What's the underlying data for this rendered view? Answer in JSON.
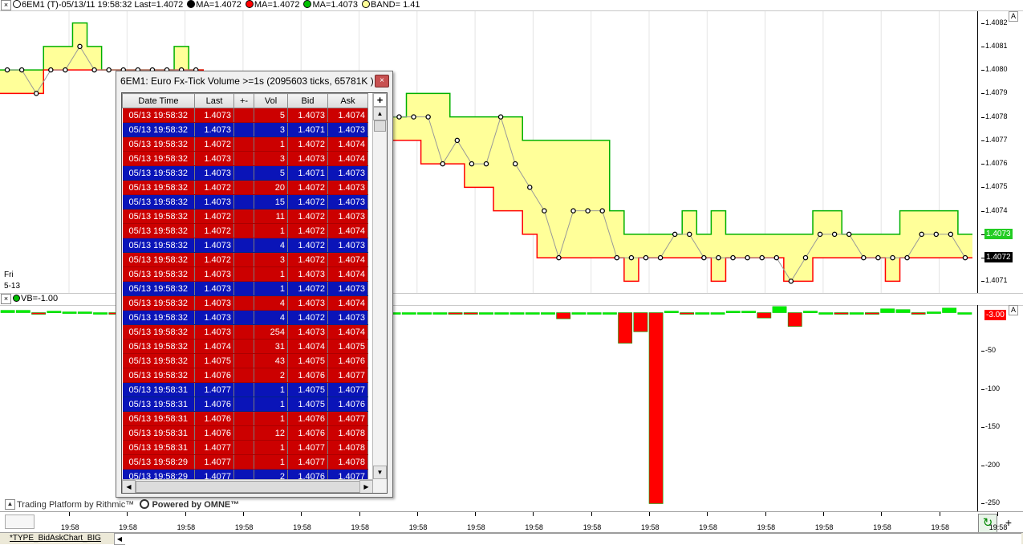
{
  "legend": {
    "close_glyph": "×",
    "symbol_text": "6EM1 (T)-05/13/11 19:58:32 Last=1.4072",
    "ma1": "MA=1.4072",
    "ma2": "MA=1.4072",
    "ma3": "MA=1.4073",
    "band": "BAND= 1.41",
    "colors": {
      "ma1": "#000000",
      "ma2": "#ff0000",
      "ma3": "#00c000",
      "band": "#ffff99"
    }
  },
  "price_axis": {
    "ticks": [
      "1.4082",
      "1.4081",
      "1.4080",
      "1.4079",
      "1.4078",
      "1.4077",
      "1.4076",
      "1.4075",
      "1.4074",
      "1.4073",
      "1.4072",
      "1.4071"
    ],
    "green_tag": "1.4073",
    "last_tag": "1.4072",
    "autoscale_label": "A"
  },
  "date_label": {
    "day": "Fri",
    "date": "5-13"
  },
  "volume_pane": {
    "legend": "VB=-1.00",
    "ticks": [
      "-50",
      "-100",
      "-150",
      "-200",
      "-250"
    ],
    "current_tag": "-3.00",
    "autoscale_label": "A"
  },
  "time_axis": {
    "labels": [
      "19:58",
      "19:58",
      "19:58",
      "19:58",
      "19:58",
      "19:58",
      "19:58",
      "19:58",
      "19:58",
      "19:58",
      "19:58",
      "19:58",
      "19:58",
      "19:58",
      "19:58",
      "19:58",
      "19:58"
    ]
  },
  "branding": {
    "rithmic": "Trading Platform by Rithmic™",
    "omne": "Powered by OMNE™"
  },
  "tab": {
    "label": "*TYPE_BidAskChart_BIG"
  },
  "popup": {
    "title": "6EM1: Euro Fx-Tick Volume >=1s (2095603 ticks, 65781K )",
    "close_glyph": "×",
    "add_glyph": "+",
    "columns": [
      "Date Time",
      "Last",
      "+-",
      "Vol",
      "Bid",
      "Ask"
    ],
    "rows": [
      {
        "side": "red",
        "dt": "05/13 19:58:32",
        "last": "1.4073",
        "vol": "5",
        "bid": "1.4073",
        "ask": "1.4074"
      },
      {
        "side": "blue",
        "dt": "05/13 19:58:32",
        "last": "1.4073",
        "vol": "3",
        "bid": "1.4071",
        "ask": "1.4073"
      },
      {
        "side": "red",
        "dt": "05/13 19:58:32",
        "last": "1.4072",
        "vol": "1",
        "bid": "1.4072",
        "ask": "1.4074"
      },
      {
        "side": "red",
        "dt": "05/13 19:58:32",
        "last": "1.4073",
        "vol": "3",
        "bid": "1.4073",
        "ask": "1.4074"
      },
      {
        "side": "blue",
        "dt": "05/13 19:58:32",
        "last": "1.4073",
        "vol": "5",
        "bid": "1.4071",
        "ask": "1.4073"
      },
      {
        "side": "red",
        "dt": "05/13 19:58:32",
        "last": "1.4072",
        "vol": "20",
        "bid": "1.4072",
        "ask": "1.4073"
      },
      {
        "side": "blue",
        "dt": "05/13 19:58:32",
        "last": "1.4073",
        "vol": "15",
        "bid": "1.4072",
        "ask": "1.4073"
      },
      {
        "side": "red",
        "dt": "05/13 19:58:32",
        "last": "1.4072",
        "vol": "11",
        "bid": "1.4072",
        "ask": "1.4073"
      },
      {
        "side": "red",
        "dt": "05/13 19:58:32",
        "last": "1.4072",
        "vol": "1",
        "bid": "1.4072",
        "ask": "1.4074"
      },
      {
        "side": "blue",
        "dt": "05/13 19:58:32",
        "last": "1.4073",
        "vol": "4",
        "bid": "1.4072",
        "ask": "1.4073"
      },
      {
        "side": "red",
        "dt": "05/13 19:58:32",
        "last": "1.4072",
        "vol": "3",
        "bid": "1.4072",
        "ask": "1.4074"
      },
      {
        "side": "red",
        "dt": "05/13 19:58:32",
        "last": "1.4073",
        "vol": "1",
        "bid": "1.4073",
        "ask": "1.4074"
      },
      {
        "side": "blue",
        "dt": "05/13 19:58:32",
        "last": "1.4073",
        "vol": "1",
        "bid": "1.4072",
        "ask": "1.4073"
      },
      {
        "side": "red",
        "dt": "05/13 19:58:32",
        "last": "1.4073",
        "vol": "4",
        "bid": "1.4073",
        "ask": "1.4074"
      },
      {
        "side": "blue",
        "dt": "05/13 19:58:32",
        "last": "1.4073",
        "vol": "4",
        "bid": "1.4072",
        "ask": "1.4073"
      },
      {
        "side": "red",
        "dt": "05/13 19:58:32",
        "last": "1.4073",
        "vol": "254",
        "bid": "1.4073",
        "ask": "1.4074"
      },
      {
        "side": "red",
        "dt": "05/13 19:58:32",
        "last": "1.4074",
        "vol": "31",
        "bid": "1.4074",
        "ask": "1.4075"
      },
      {
        "side": "red",
        "dt": "05/13 19:58:32",
        "last": "1.4075",
        "vol": "43",
        "bid": "1.4075",
        "ask": "1.4076"
      },
      {
        "side": "red",
        "dt": "05/13 19:58:32",
        "last": "1.4076",
        "vol": "2",
        "bid": "1.4076",
        "ask": "1.4077"
      },
      {
        "side": "blue",
        "dt": "05/13 19:58:31",
        "last": "1.4077",
        "vol": "1",
        "bid": "1.4075",
        "ask": "1.4077"
      },
      {
        "side": "blue",
        "dt": "05/13 19:58:31",
        "last": "1.4076",
        "vol": "1",
        "bid": "1.4075",
        "ask": "1.4076"
      },
      {
        "side": "red",
        "dt": "05/13 19:58:31",
        "last": "1.4076",
        "vol": "1",
        "bid": "1.4076",
        "ask": "1.4077"
      },
      {
        "side": "red",
        "dt": "05/13 19:58:31",
        "last": "1.4076",
        "vol": "12",
        "bid": "1.4076",
        "ask": "1.4078"
      },
      {
        "side": "red",
        "dt": "05/13 19:58:31",
        "last": "1.4077",
        "vol": "1",
        "bid": "1.4077",
        "ask": "1.4078"
      },
      {
        "side": "red",
        "dt": "05/13 19:58:29",
        "last": "1.4077",
        "vol": "1",
        "bid": "1.4077",
        "ask": "1.4078"
      },
      {
        "side": "blue",
        "dt": "05/13 19:58:29",
        "last": "1.4077",
        "vol": "2",
        "bid": "1.4076",
        "ask": "1.4077"
      }
    ]
  },
  "chart_data": {
    "type": "line",
    "ylim": [
      1.40705,
      1.40825
    ],
    "series": [
      {
        "values": [
          1.408,
          1.408,
          1.408,
          1.4081,
          1.4081,
          1.4082,
          1.4081,
          1.408,
          1.408,
          1.408,
          1.408,
          1.408,
          1.4081,
          1.408,
          1.4079,
          1.4079,
          1.4079,
          1.4079,
          1.4079,
          1.4079,
          1.4079,
          1.4079,
          1.4079,
          1.4079,
          1.4078,
          1.4078,
          1.4078,
          1.4078,
          1.4079,
          1.4079,
          1.4079,
          1.4078,
          1.4078,
          1.4078,
          1.4078,
          1.4078,
          1.4077,
          1.4077,
          1.4077,
          1.4077,
          1.4077,
          1.4077,
          1.4074,
          1.4073,
          1.4073,
          1.4073,
          1.4073,
          1.4074,
          1.4073,
          1.4074,
          1.4073,
          1.4073,
          1.4073,
          1.4073,
          1.4073,
          1.4073,
          1.4074,
          1.4074,
          1.4073,
          1.4073,
          1.4073,
          1.4073,
          1.4074,
          1.4074,
          1.4074,
          1.4074,
          1.4073
        ]
      },
      {
        "values": [
          1.4079,
          1.4079,
          1.4079,
          1.408,
          1.408,
          1.408,
          1.408,
          1.408,
          1.408,
          1.408,
          1.408,
          1.408,
          1.408,
          1.408,
          1.4078,
          1.4078,
          1.4078,
          1.4078,
          1.4078,
          1.4078,
          1.4078,
          1.4078,
          1.4078,
          1.4078,
          1.4078,
          1.4078,
          1.4078,
          1.4077,
          1.4077,
          1.4076,
          1.4076,
          1.4076,
          1.4075,
          1.4075,
          1.4074,
          1.4074,
          1.4073,
          1.4072,
          1.4072,
          1.4072,
          1.4072,
          1.4072,
          1.4072,
          1.4071,
          1.4072,
          1.4072,
          1.4072,
          1.4072,
          1.4072,
          1.4071,
          1.4072,
          1.4072,
          1.4072,
          1.4072,
          1.4071,
          1.4071,
          1.4072,
          1.4072,
          1.4072,
          1.4072,
          1.4072,
          1.4071,
          1.4072,
          1.4072,
          1.4072,
          1.4072,
          1.4072
        ]
      }
    ],
    "volume": {
      "ylim": [
        -260,
        10
      ],
      "values": [
        3,
        3,
        -2,
        2,
        1,
        1,
        0,
        -1,
        1,
        0,
        0,
        0,
        -1,
        0,
        0,
        0,
        0,
        0,
        0,
        0,
        0,
        0,
        0,
        0,
        0,
        0,
        0,
        0,
        0,
        -2,
        -2,
        0,
        0,
        0,
        0,
        0,
        -8,
        0,
        0,
        0,
        -40,
        -25,
        -250,
        2,
        -2,
        0,
        0,
        2,
        2,
        -7,
        8,
        -18,
        2,
        0,
        -2,
        0,
        -1,
        5,
        4,
        -2,
        1,
        6,
        0
      ]
    }
  }
}
